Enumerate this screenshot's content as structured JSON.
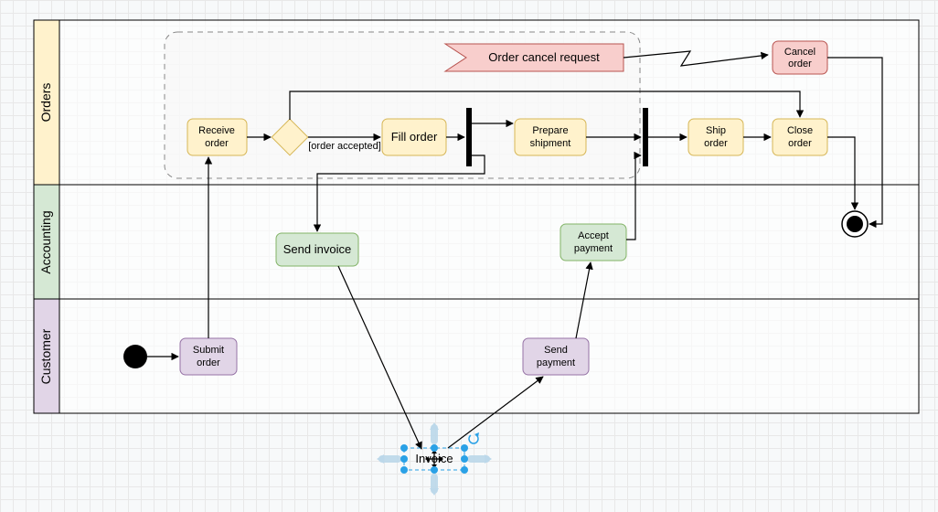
{
  "swimlanes": {
    "orders": "Orders",
    "accounting": "Accounting",
    "customer": "Customer"
  },
  "nodes": {
    "order_cancel_request": "Order cancel request",
    "cancel_order_1": "Cancel",
    "cancel_order_2": "order",
    "receive_order_1": "Receive",
    "receive_order_2": "order",
    "guard": "[order accepted]",
    "fill_order": "Fill order",
    "prepare_shipment_1": "Prepare",
    "prepare_shipment_2": "shipment",
    "ship_order_1": "Ship",
    "ship_order_2": "order",
    "close_order_1": "Close",
    "close_order_2": "order",
    "send_invoice": "Send invoice",
    "accept_payment_1": "Accept",
    "accept_payment_2": "payment",
    "submit_order_1": "Submit",
    "submit_order_2": "order",
    "send_payment_1": "Send",
    "send_payment_2": "payment",
    "invoice": "Invoice"
  },
  "selection": {
    "label": "Invoice"
  }
}
